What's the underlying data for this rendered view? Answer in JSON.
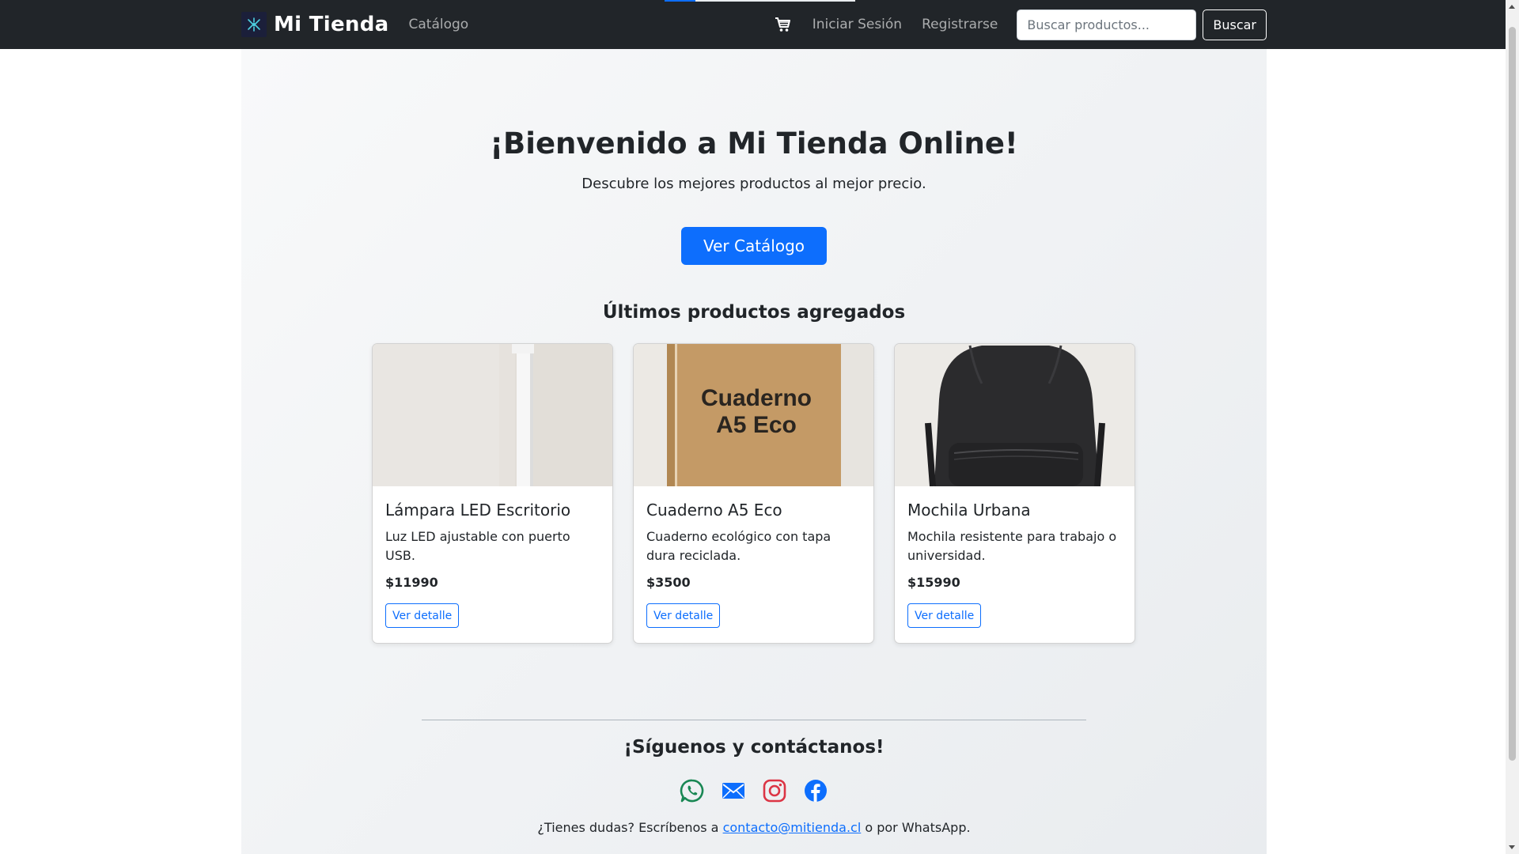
{
  "navbar": {
    "brand": "Mi Tienda",
    "catalog_link": "Catálogo",
    "cart_icon": "shopping-cart-icon",
    "login_link": "Iniciar Sesión",
    "register_link": "Registrarse",
    "search_placeholder": "Buscar productos...",
    "search_button": "Buscar",
    "page_load_progress": 0.16
  },
  "hero": {
    "title": "¡Bienvenido a Mi Tienda Online!",
    "subtitle": "Descubre los mejores productos al mejor precio.",
    "button": "Ver Catálogo"
  },
  "latest": {
    "title": "Últimos productos agregados",
    "products": [
      {
        "name": "Lámpara LED Escritorio",
        "description": "Luz LED ajustable con puerto USB.",
        "price": "$11990",
        "button": "Ver detalle"
      },
      {
        "name": "Cuaderno A5 Eco",
        "description": "Cuaderno ecológico con tapa dura reciclada.",
        "price": "$3500",
        "button": "Ver detalle",
        "image_text_line1": "Cuaderno",
        "image_text_line2": "A5 Eco"
      },
      {
        "name": "Mochila Urbana",
        "description": "Mochila resistente para trabajo o universidad.",
        "price": "$15990",
        "button": "Ver detalle"
      }
    ]
  },
  "footer": {
    "title": "¡Síguenos y contáctanos!",
    "social_icons": [
      "whatsapp-icon",
      "email-icon",
      "instagram-icon",
      "facebook-icon"
    ],
    "contact_prefix": "¿Tienes dudas? Escríbenos a",
    "contact_email": "contacto@mitienda.cl",
    "contact_suffix": "o por WhatsApp."
  },
  "colors": {
    "navbar_bg": "#212529",
    "primary": "#0d6efd",
    "whatsapp": "#198754",
    "email": "#0d6efd",
    "instagram": "#dc3545",
    "facebook": "#0d6efd"
  }
}
